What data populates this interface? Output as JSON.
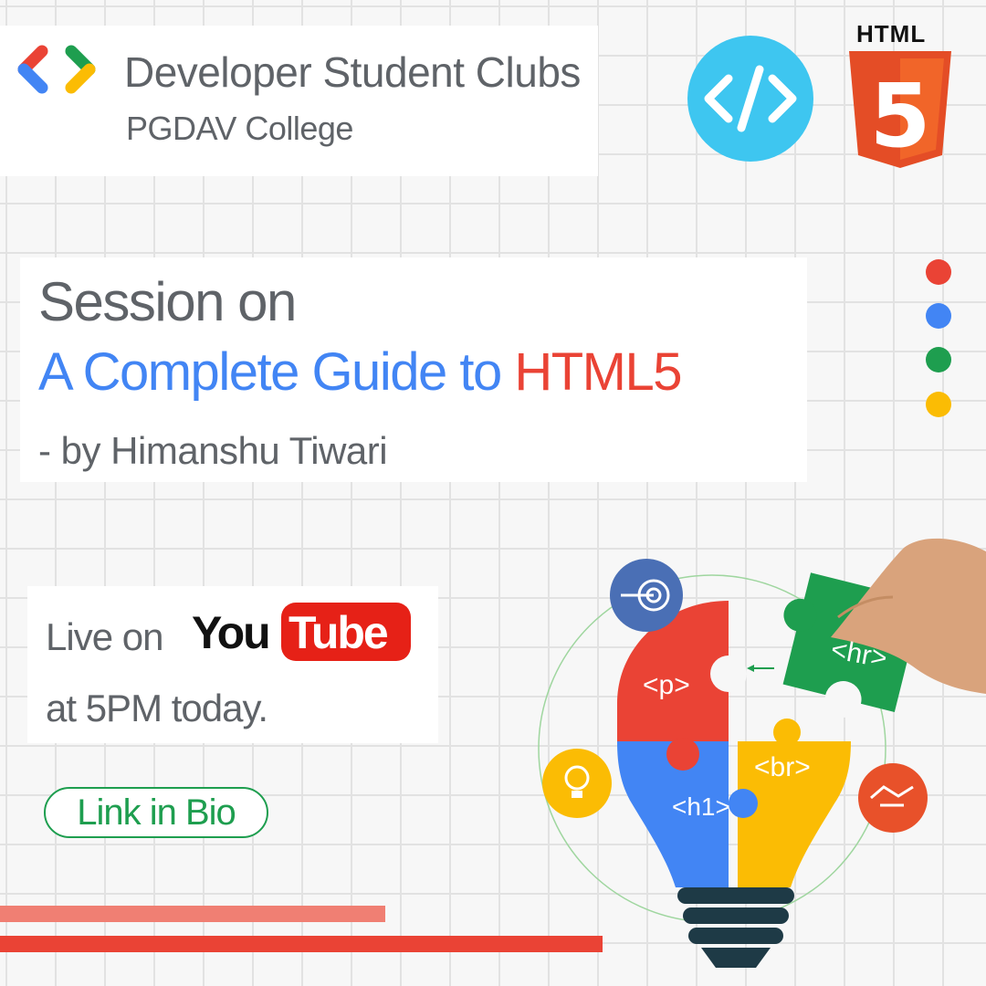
{
  "header": {
    "org_name": "Developer Student Clubs",
    "college": "PGDAV College",
    "badge_text": "HTML",
    "badge_number": "5"
  },
  "title": {
    "line1": "Session on",
    "line2_part1": "A Complete Guide to ",
    "line2_part2": "HTML5",
    "speaker": "- by Himanshu Tiwari"
  },
  "live": {
    "prefix": "Live on ",
    "youtube_you": "You",
    "youtube_tube": "Tube",
    "time": "at 5PM today."
  },
  "cta": {
    "label": "Link in Bio"
  },
  "puzzle": {
    "p_tag": "<p>",
    "hr_tag": "<hr>",
    "h1_tag": "<h1>",
    "br_tag": "<br>"
  },
  "colors": {
    "google_red": "#ea4335",
    "google_blue": "#4285f4",
    "google_green": "#1e9e4f",
    "google_yellow": "#fbbc04",
    "text_gray": "#5f6368",
    "html5_orange": "#e44d26",
    "code_circle": "#3ec6f0"
  },
  "icons": [
    "dsc-logo-icon",
    "code-icon",
    "html5-shield-icon",
    "target-icon",
    "lightbulb-icon",
    "handshake-icon",
    "hand-icon",
    "bulb-base-icon"
  ]
}
